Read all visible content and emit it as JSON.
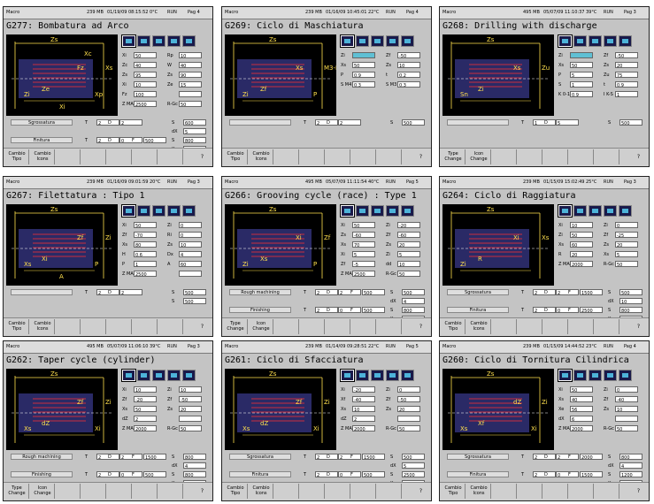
{
  "panels": [
    {
      "app": "Macro",
      "mem": "239 MB",
      "date": "01/19/09",
      "time": "08:15:52",
      "temp": "0°C",
      "status": "RUN",
      "page": "Pag 4",
      "title": "G277: Bombatura ad Arco",
      "drawing_labels": [
        "Zs",
        "Xs",
        "Fz",
        "Ze",
        "Zi",
        "Xp",
        "Xi",
        "Xc"
      ],
      "fields_left": [
        [
          "Xi",
          "50"
        ],
        [
          "Zc",
          "40"
        ],
        [
          "Zs",
          "95"
        ],
        [
          "Xi",
          "10"
        ],
        [
          "Fz",
          "100"
        ],
        [
          "Z MAX",
          "2500"
        ]
      ],
      "fields_right": [
        [
          "Rp",
          "10"
        ],
        [
          "W",
          "40"
        ],
        [
          "Zs",
          "90"
        ],
        [
          "Ze",
          "15"
        ],
        [
          "",
          ""
        ],
        [
          "R-Gc",
          "50"
        ]
      ],
      "row1": {
        "label": "Sgrossatura",
        "t": "2",
        "d": "2",
        "s": "600"
      },
      "row2": {
        "label": "Finitura",
        "t": "2",
        "d": "0",
        "f": "500",
        "s": "800"
      },
      "extra": [
        [
          "dX",
          "5"
        ],
        [
          "Xe",
          "1"
        ]
      ],
      "buttons": [
        "Cambio Tipo",
        "Cambio Icons"
      ]
    },
    {
      "app": "Macro",
      "mem": "239 MB",
      "date": "01/16/09",
      "time": "10:45:01",
      "temp": "22°C",
      "status": "RUN",
      "page": "Pag 4",
      "title": "G269: Ciclo di Maschiatura",
      "drawing_labels": [
        "Zs",
        "M3-M4",
        "Xs",
        "Zf",
        "Zi",
        "P"
      ],
      "fields_left": [
        [
          "Zi",
          ""
        ],
        [
          "Xs",
          "50"
        ],
        [
          "P",
          "0.9"
        ],
        [
          "S M4",
          "0.3"
        ]
      ],
      "fields_right": [
        [
          "Zf",
          "-50"
        ],
        [
          "Zs",
          "10"
        ],
        [
          "t",
          "0.2"
        ],
        [
          "S M3",
          "0.3"
        ]
      ],
      "row1": {
        "label": "",
        "t": "2",
        "d": "2",
        "s": "500"
      },
      "row2": null,
      "extra": [],
      "buttons": [
        "Cambio Tipo",
        "Cambio Icons"
      ]
    },
    {
      "app": "Macro",
      "mem": "495 MB",
      "date": "05/07/09",
      "time": "11:10:37",
      "temp": "39°C",
      "status": "RUN",
      "page": "Pag 3",
      "title": "G268: Drilling with discharge",
      "drawing_labels": [
        "Zs",
        "Zu",
        "Xs",
        "Zi",
        "Sn"
      ],
      "fields_left": [
        [
          "Zi",
          ""
        ],
        [
          "Xs",
          "50"
        ],
        [
          "P",
          "5"
        ],
        [
          "S",
          "1"
        ],
        [
          "K 0-1",
          "0.9"
        ]
      ],
      "fields_right": [
        [
          "Zf",
          "-50"
        ],
        [
          "Zs",
          "20"
        ],
        [
          "Zu",
          "75"
        ],
        [
          "t",
          "0.9"
        ],
        [
          "I K-S",
          "1"
        ]
      ],
      "row1": {
        "label": "",
        "t": "1",
        "d": "5",
        "s": "500"
      },
      "row2": null,
      "extra": [],
      "buttons": [
        "Type Change",
        "Icon Change"
      ]
    },
    {
      "app": "Macro",
      "mem": "239 MB",
      "date": "01/16/09",
      "time": "09:01:59",
      "temp": "20°C",
      "status": "RUN",
      "page": "Pag 3",
      "title": "G267: Filettatura : Tipo 1",
      "drawing_labels": [
        "Zs",
        "Zi",
        "Zf",
        "Xi",
        "Xs",
        "P",
        "A"
      ],
      "fields_left": [
        [
          "Xi",
          "50"
        ],
        [
          "Zf",
          "-70"
        ],
        [
          "Xs",
          "80"
        ],
        [
          "H",
          "0.6"
        ],
        [
          "P",
          "1"
        ],
        [
          "Z MAX",
          "2500"
        ]
      ],
      "fields_right": [
        [
          "Zi",
          "0"
        ],
        [
          "Ri",
          "0"
        ],
        [
          "Zs",
          "10"
        ],
        [
          "Dx",
          "4"
        ],
        [
          "A",
          "60"
        ],
        [
          "",
          ""
        ]
      ],
      "row1": {
        "label": "",
        "t": "2",
        "d": "2",
        "s": "500"
      },
      "row2": null,
      "extra": [
        [
          "S",
          "500"
        ]
      ],
      "buttons": [
        "Cambio Tipo",
        "Cambio Icons"
      ]
    },
    {
      "app": "Macro",
      "mem": "495 MB",
      "date": "05/07/09",
      "time": "11:11:54",
      "temp": "40°C",
      "status": "RUN",
      "page": "Pag 5",
      "title": "G266: Grooving cycle (race) : Type 1",
      "drawing_labels": [
        "Zs",
        "Zf",
        "Xi",
        "Xs",
        "Zi",
        "P"
      ],
      "fields_left": [
        [
          "Xi",
          "50"
        ],
        [
          "Zs",
          "-60"
        ],
        [
          "Xs",
          "70"
        ],
        [
          "Xi",
          "5"
        ],
        [
          "Zf",
          "-5"
        ],
        [
          "Z MAX",
          "2500"
        ]
      ],
      "fields_right": [
        [
          "Zi",
          "-20"
        ],
        [
          "Zf",
          "-60"
        ],
        [
          "Zs",
          "20"
        ],
        [
          "Zi",
          "5"
        ],
        [
          "dd",
          "10"
        ],
        [
          "R-Gc",
          "50"
        ]
      ],
      "row1": {
        "label": "Rough machining",
        "t": "2",
        "d": "2",
        "f": "500",
        "s": "500"
      },
      "row2": {
        "label": "Finishing",
        "t": "2",
        "d": "0",
        "f": "500",
        "s": "800"
      },
      "extra": [
        [
          "dX",
          "4"
        ],
        [
          "Xe",
          "1"
        ]
      ],
      "buttons": [
        "Type Change",
        "Icon Change"
      ]
    },
    {
      "app": "Macro",
      "mem": "239 MB",
      "date": "01/15/09",
      "time": "15:02:49",
      "temp": "25°C",
      "status": "RUN",
      "page": "Pag 3",
      "title": "G264: Ciclo di Raggiatura",
      "drawing_labels": [
        "Zs",
        "Xs",
        "Xi",
        "R",
        "Zi"
      ],
      "fields_left": [
        [
          "Xi",
          "10"
        ],
        [
          "Zi",
          "50"
        ],
        [
          "Xs",
          "60"
        ],
        [
          "R",
          "20"
        ],
        [
          "Z MAX",
          "2000"
        ]
      ],
      "fields_right": [
        [
          "Zi",
          "0"
        ],
        [
          "Zf",
          "-25"
        ],
        [
          "Zs",
          "20"
        ],
        [
          "Xs",
          "5"
        ],
        [
          "R-Gc",
          "50"
        ]
      ],
      "row1": {
        "label": "Sgrossatura",
        "t": "2",
        "d": "2",
        "f": "1500",
        "s": "500"
      },
      "row2": {
        "label": "Finitura",
        "t": "2",
        "d": "0",
        "f": "2500",
        "s": "800"
      },
      "extra": [
        [
          "dX",
          "10"
        ],
        [
          "Xe",
          "0.5"
        ]
      ],
      "buttons": [
        "Cambio Tipo",
        "Cambio Icons"
      ]
    },
    {
      "app": "Macro",
      "mem": "495 MB",
      "date": "05/07/09",
      "time": "11:06:10",
      "temp": "39°C",
      "status": "RUN",
      "page": "Pag 3",
      "title": "G262: Taper cycle (cylinder)",
      "drawing_labels": [
        "Zs",
        "Zi",
        "Zf",
        "dZ",
        "Xs",
        "Xi"
      ],
      "fields_left": [
        [
          "Xi",
          "10"
        ],
        [
          "Zf",
          "-20"
        ],
        [
          "Xs",
          "50"
        ],
        [
          "dZ",
          "2"
        ],
        [
          "Z MAX",
          "2000"
        ]
      ],
      "fields_right": [
        [
          "Zi",
          "10"
        ],
        [
          "Zf",
          "-50"
        ],
        [
          "Zs",
          "20"
        ],
        [
          "",
          ""
        ],
        [
          "R-Gc",
          "50"
        ]
      ],
      "row1": {
        "label": "Rough machining",
        "t": "2",
        "d": "2",
        "f": "1500",
        "s": "800"
      },
      "row2": {
        "label": "Finishing",
        "t": "2",
        "d": "0",
        "f": "500",
        "s": "800"
      },
      "extra": [
        [
          "dX",
          "4"
        ],
        [
          "Xe",
          "1"
        ]
      ],
      "buttons": [
        "Type Change",
        "Icon Change"
      ]
    },
    {
      "app": "Macro",
      "mem": "239 MB",
      "date": "01/14/09",
      "time": "09:28:51",
      "temp": "22°C",
      "status": "RUN",
      "page": "Pag 5",
      "title": "G261: Ciclo di Sfacciatura",
      "drawing_labels": [
        "Zs",
        "Zi",
        "Zf",
        "dZ",
        "Xs",
        "Xi"
      ],
      "fields_left": [
        [
          "Xi",
          "-20"
        ],
        [
          "Xf",
          "-40"
        ],
        [
          "Xs",
          "10"
        ],
        [
          "dZ",
          "2"
        ],
        [
          "Z MAX",
          "2000"
        ]
      ],
      "fields_right": [
        [
          "Zi",
          "0"
        ],
        [
          "Zf",
          "-50"
        ],
        [
          "Zs",
          "20"
        ],
        [
          "",
          ""
        ],
        [
          "R-Gc",
          "50"
        ]
      ],
      "row1": {
        "label": "Sgrossatura",
        "t": "2",
        "d": "2",
        "f": "1500",
        "s": "500"
      },
      "row2": {
        "label": "Finitura",
        "t": "2",
        "d": "0",
        "f": "500",
        "s": "2500"
      },
      "extra": [
        [
          "dX",
          "5"
        ],
        [
          "Xe",
          "0.2"
        ]
      ],
      "buttons": [
        "Cambio Tipo",
        "Cambio Icons"
      ]
    },
    {
      "app": "Macro",
      "mem": "239 MB",
      "date": "01/15/09",
      "time": "14:44:52",
      "temp": "23°C",
      "status": "RUN",
      "page": "Pag 4",
      "title": "G260: Ciclo di Tornitura Cilindrica",
      "drawing_labels": [
        "Zs",
        "Zi",
        "dZ",
        "Xf",
        "Xs",
        "Xi"
      ],
      "fields_left": [
        [
          "Xi",
          "50"
        ],
        [
          "Xs",
          "40"
        ],
        [
          "Xe",
          "56"
        ],
        [
          "dX",
          "6"
        ],
        [
          "Z MAX",
          "2000"
        ]
      ],
      "fields_right": [
        [
          "Zi",
          "0"
        ],
        [
          "Zf",
          "-40"
        ],
        [
          "Zs",
          "10"
        ],
        [
          "",
          ""
        ],
        [
          "R-Gc",
          "50"
        ]
      ],
      "row1": {
        "label": "Sgrossatura",
        "t": "2",
        "d": "2",
        "f": "2000",
        "s": "800"
      },
      "row2": {
        "label": "Finitura",
        "t": "2",
        "d": "0",
        "f": "1500",
        "s": "1200"
      },
      "extra": [
        [
          "dX",
          "4"
        ],
        [
          "Xe",
          "0.5"
        ]
      ],
      "buttons": [
        "Cambio Tipo",
        "Cambio Icons"
      ]
    }
  ]
}
